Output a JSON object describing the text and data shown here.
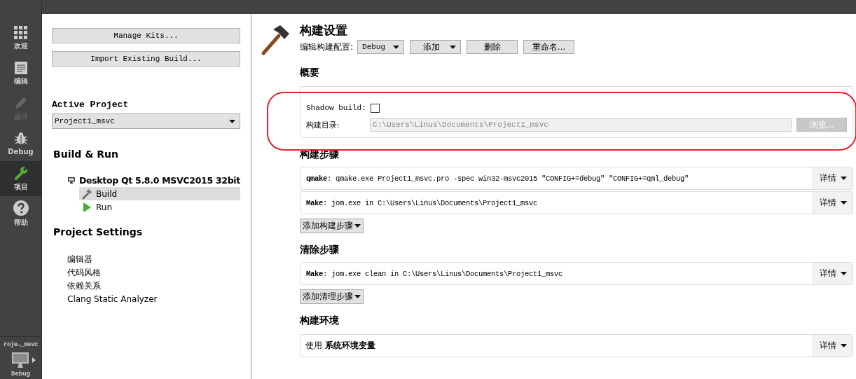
{
  "mode_bar": {
    "items": [
      {
        "label": "欢迎",
        "selected": false,
        "disabled": false
      },
      {
        "label": "编辑",
        "selected": false,
        "disabled": false
      },
      {
        "label": "设计",
        "selected": false,
        "disabled": true
      },
      {
        "label": "Debug",
        "selected": false,
        "disabled": false
      },
      {
        "label": "项目",
        "selected": true,
        "disabled": false
      },
      {
        "label": "帮助",
        "selected": false,
        "disabled": false
      }
    ],
    "target": {
      "project": "roje…_msvc",
      "build": "Debug"
    }
  },
  "kit_panel": {
    "buttons": [
      "Manage Kits...",
      "Import Existing Build..."
    ],
    "active_project": {
      "label": "Active Project",
      "value": "Project1_msvc"
    },
    "build_run": {
      "title": "Build & Run",
      "kit": "Desktop Qt 5.8.0 MSVC2015 32bit",
      "children": [
        {
          "label": "Build",
          "kind": "build",
          "selected": true
        },
        {
          "label": "Run",
          "kind": "run",
          "selected": false
        }
      ]
    },
    "project_settings": {
      "title": "Project Settings",
      "items": [
        "编辑器",
        "代码风格",
        "依赖关系",
        "Clang Static Analyzer"
      ]
    }
  },
  "build_settings": {
    "title": "构建设置",
    "config": {
      "label": "编辑构建配置:",
      "value": "Debug",
      "buttons": [
        {
          "label": "添加",
          "kind": "menu"
        },
        {
          "label": "删除",
          "kind": "plain"
        },
        {
          "label": "重命名...",
          "kind": "plain"
        }
      ]
    },
    "summary": {
      "title": "概要",
      "shadow_build": {
        "label": "Shadow build:",
        "checked": false
      },
      "build_dir": {
        "label": "构建目录:",
        "value": "C:\\Users\\Linus\\Documents\\Project1_msvc",
        "disabled": true
      },
      "browse": {
        "label": "浏览...",
        "disabled": true
      }
    },
    "build_steps": {
      "title": "构建步骤",
      "steps": [
        {
          "command": "**qmake**: qmake.exe Project1_msvc.pro -spec win32-msvc2015 \"CONFIG+=debug\" \"CONFIG+=qml_debug\"",
          "details": "详情"
        },
        {
          "command": "**Make**: jom.exe in C:\\Users\\Linus\\Documents\\Project1_msvc",
          "details": "详情"
        }
      ],
      "add": "添加构建步骤"
    },
    "clean_steps": {
      "title": "清除步骤",
      "steps": [
        {
          "command": "**Make**: jom.exe clean in C:\\Users\\Linus\\Documents\\Project1_msvc",
          "details": "详情"
        }
      ],
      "add": "添加清理步骤"
    },
    "environment": {
      "title": "构建环境",
      "text": "使用 **系统环境变量**",
      "details": "详情"
    }
  },
  "annotation": {
    "kind": "outline"
  }
}
